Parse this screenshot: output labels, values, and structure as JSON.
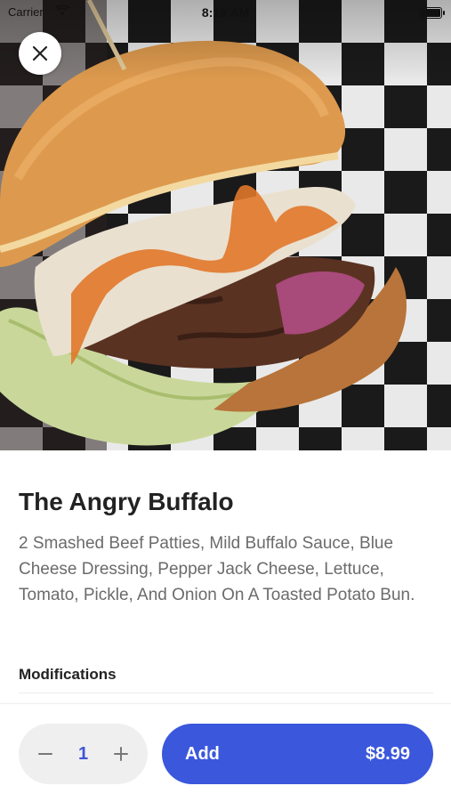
{
  "status_bar": {
    "carrier": "Carrier",
    "time": "8:19 AM"
  },
  "hero": {
    "image_alt": "Burger photo"
  },
  "item": {
    "title": "The Angry Buffalo",
    "description": "2 Smashed Beef Patties, Mild Buffalo Sauce, Blue Cheese Dressing, Pepper Jack Cheese, Lettuce, Tomato, Pickle, And Onion On A Toasted Potato Bun.",
    "modifications_label": "Modifications"
  },
  "cart": {
    "quantity": "1",
    "add_label": "Add",
    "price": "$8.99"
  },
  "colors": {
    "accent": "#3b57dc",
    "quantity_text": "#3f56d6"
  },
  "icons": {
    "close": "close-icon",
    "minus": "minus-icon",
    "plus": "plus-icon",
    "wifi": "wifi-icon",
    "battery": "battery-icon"
  }
}
